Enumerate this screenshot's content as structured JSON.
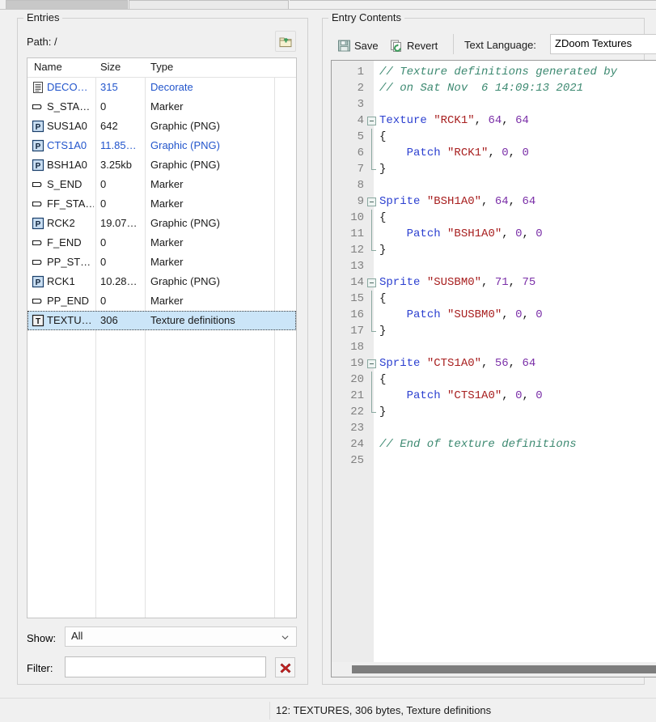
{
  "window": {
    "tabs": [
      {
        "label": "",
        "active": true
      },
      {
        "label": "",
        "active": false
      }
    ]
  },
  "entries_panel": {
    "title": "Entries",
    "path_label": "Path: /",
    "updir_icon": "folder-up-icon",
    "columns": [
      "Name",
      "Size",
      "Type"
    ],
    "rows": [
      {
        "icon": "text-document-icon",
        "name": "DECO…",
        "size": "315",
        "type": "Decorate",
        "highlight": true,
        "selected": false
      },
      {
        "icon": "marker-tag-icon",
        "name": "S_STA…",
        "size": "0",
        "type": "Marker",
        "highlight": false,
        "selected": false
      },
      {
        "icon": "png-badge-icon",
        "name": "SUS1A0",
        "size": "642",
        "type": "Graphic (PNG)",
        "highlight": false,
        "selected": false
      },
      {
        "icon": "png-badge-icon",
        "name": "CTS1A0",
        "size": "11.85…",
        "type": "Graphic (PNG)",
        "highlight": true,
        "selected": false
      },
      {
        "icon": "png-badge-icon",
        "name": "BSH1A0",
        "size": "3.25kb",
        "type": "Graphic (PNG)",
        "highlight": false,
        "selected": false
      },
      {
        "icon": "marker-tag-icon",
        "name": "S_END",
        "size": "0",
        "type": "Marker",
        "highlight": false,
        "selected": false
      },
      {
        "icon": "marker-tag-icon",
        "name": "FF_STA…",
        "size": "0",
        "type": "Marker",
        "highlight": false,
        "selected": false
      },
      {
        "icon": "png-badge-icon",
        "name": "RCK2",
        "size": "19.07…",
        "type": "Graphic (PNG)",
        "highlight": false,
        "selected": false
      },
      {
        "icon": "marker-tag-icon",
        "name": "F_END",
        "size": "0",
        "type": "Marker",
        "highlight": false,
        "selected": false
      },
      {
        "icon": "marker-tag-icon",
        "name": "PP_ST…",
        "size": "0",
        "type": "Marker",
        "highlight": false,
        "selected": false
      },
      {
        "icon": "png-badge-icon",
        "name": "RCK1",
        "size": "10.28…",
        "type": "Graphic (PNG)",
        "highlight": false,
        "selected": false
      },
      {
        "icon": "marker-tag-icon",
        "name": "PP_END",
        "size": "0",
        "type": "Marker",
        "highlight": false,
        "selected": false
      },
      {
        "icon": "texture-badge-icon",
        "name": "TEXTU…",
        "size": "306",
        "type": "Texture definitions",
        "highlight": false,
        "selected": true
      }
    ],
    "show_label": "Show:",
    "show_value": "All",
    "show_options": [
      "All"
    ],
    "filter_label": "Filter:",
    "filter_value": "",
    "filter_placeholder": "",
    "clear_icon": "red-x-icon"
  },
  "contents_panel": {
    "title": "Entry Contents",
    "save_label": "Save",
    "save_icon": "floppy-disk-icon",
    "revert_label": "Revert",
    "revert_icon": "revert-pages-icon",
    "language_label": "Text Language:",
    "language_value": "ZDoom Textures",
    "language_options": [
      "ZDoom Textures"
    ]
  },
  "editor": {
    "first_line": 1,
    "last_line": 25,
    "lines": [
      {
        "n": "1",
        "fold": "none",
        "tokens": [
          {
            "t": "comment",
            "v": "// Texture definitions generated by"
          }
        ]
      },
      {
        "n": "2",
        "fold": "none",
        "tokens": [
          {
            "t": "comment",
            "v": "// on Sat Nov  6 14:09:13 2021"
          }
        ]
      },
      {
        "n": "3",
        "fold": "none",
        "tokens": []
      },
      {
        "n": "4",
        "fold": "open",
        "tokens": [
          {
            "t": "keyword",
            "v": "Texture"
          },
          {
            "t": "punct",
            "v": " "
          },
          {
            "t": "string",
            "v": "\"RCK1\""
          },
          {
            "t": "punct",
            "v": ", "
          },
          {
            "t": "number",
            "v": "64"
          },
          {
            "t": "punct",
            "v": ", "
          },
          {
            "t": "number",
            "v": "64"
          }
        ]
      },
      {
        "n": "5",
        "fold": "bar",
        "tokens": [
          {
            "t": "punct",
            "v": "{"
          }
        ]
      },
      {
        "n": "6",
        "fold": "bar",
        "tokens": [
          {
            "t": "punct",
            "v": "    "
          },
          {
            "t": "keyword",
            "v": "Patch"
          },
          {
            "t": "punct",
            "v": " "
          },
          {
            "t": "string",
            "v": "\"RCK1\""
          },
          {
            "t": "punct",
            "v": ", "
          },
          {
            "t": "number",
            "v": "0"
          },
          {
            "t": "punct",
            "v": ", "
          },
          {
            "t": "number",
            "v": "0"
          }
        ]
      },
      {
        "n": "7",
        "fold": "close",
        "tokens": [
          {
            "t": "punct",
            "v": "}"
          }
        ]
      },
      {
        "n": "8",
        "fold": "none",
        "tokens": []
      },
      {
        "n": "9",
        "fold": "open",
        "tokens": [
          {
            "t": "keyword",
            "v": "Sprite"
          },
          {
            "t": "punct",
            "v": " "
          },
          {
            "t": "string",
            "v": "\"BSH1A0\""
          },
          {
            "t": "punct",
            "v": ", "
          },
          {
            "t": "number",
            "v": "64"
          },
          {
            "t": "punct",
            "v": ", "
          },
          {
            "t": "number",
            "v": "64"
          }
        ]
      },
      {
        "n": "10",
        "fold": "bar",
        "tokens": [
          {
            "t": "punct",
            "v": "{"
          }
        ]
      },
      {
        "n": "11",
        "fold": "bar",
        "tokens": [
          {
            "t": "punct",
            "v": "    "
          },
          {
            "t": "keyword",
            "v": "Patch"
          },
          {
            "t": "punct",
            "v": " "
          },
          {
            "t": "string",
            "v": "\"BSH1A0\""
          },
          {
            "t": "punct",
            "v": ", "
          },
          {
            "t": "number",
            "v": "0"
          },
          {
            "t": "punct",
            "v": ", "
          },
          {
            "t": "number",
            "v": "0"
          }
        ]
      },
      {
        "n": "12",
        "fold": "close",
        "tokens": [
          {
            "t": "punct",
            "v": "}"
          }
        ]
      },
      {
        "n": "13",
        "fold": "none",
        "tokens": []
      },
      {
        "n": "14",
        "fold": "open",
        "tokens": [
          {
            "t": "keyword",
            "v": "Sprite"
          },
          {
            "t": "punct",
            "v": " "
          },
          {
            "t": "string",
            "v": "\"SUSBM0\""
          },
          {
            "t": "punct",
            "v": ", "
          },
          {
            "t": "number",
            "v": "71"
          },
          {
            "t": "punct",
            "v": ", "
          },
          {
            "t": "number",
            "v": "75"
          }
        ]
      },
      {
        "n": "15",
        "fold": "bar",
        "tokens": [
          {
            "t": "punct",
            "v": "{"
          }
        ]
      },
      {
        "n": "16",
        "fold": "bar",
        "tokens": [
          {
            "t": "punct",
            "v": "    "
          },
          {
            "t": "keyword",
            "v": "Patch"
          },
          {
            "t": "punct",
            "v": " "
          },
          {
            "t": "string",
            "v": "\"SUSBM0\""
          },
          {
            "t": "punct",
            "v": ", "
          },
          {
            "t": "number",
            "v": "0"
          },
          {
            "t": "punct",
            "v": ", "
          },
          {
            "t": "number",
            "v": "0"
          }
        ]
      },
      {
        "n": "17",
        "fold": "close",
        "tokens": [
          {
            "t": "punct",
            "v": "}"
          }
        ]
      },
      {
        "n": "18",
        "fold": "none",
        "tokens": []
      },
      {
        "n": "19",
        "fold": "open",
        "tokens": [
          {
            "t": "keyword",
            "v": "Sprite"
          },
          {
            "t": "punct",
            "v": " "
          },
          {
            "t": "string",
            "v": "\"CTS1A0\""
          },
          {
            "t": "punct",
            "v": ", "
          },
          {
            "t": "number",
            "v": "56"
          },
          {
            "t": "punct",
            "v": ", "
          },
          {
            "t": "number",
            "v": "64"
          }
        ]
      },
      {
        "n": "20",
        "fold": "bar",
        "tokens": [
          {
            "t": "punct",
            "v": "{"
          }
        ]
      },
      {
        "n": "21",
        "fold": "bar",
        "tokens": [
          {
            "t": "punct",
            "v": "    "
          },
          {
            "t": "keyword",
            "v": "Patch"
          },
          {
            "t": "punct",
            "v": " "
          },
          {
            "t": "string",
            "v": "\"CTS1A0\""
          },
          {
            "t": "punct",
            "v": ", "
          },
          {
            "t": "number",
            "v": "0"
          },
          {
            "t": "punct",
            "v": ", "
          },
          {
            "t": "number",
            "v": "0"
          }
        ]
      },
      {
        "n": "22",
        "fold": "close",
        "tokens": [
          {
            "t": "punct",
            "v": "}"
          }
        ]
      },
      {
        "n": "23",
        "fold": "none",
        "tokens": []
      },
      {
        "n": "24",
        "fold": "none",
        "tokens": [
          {
            "t": "comment",
            "v": "// End of texture definitions"
          }
        ]
      },
      {
        "n": "25",
        "fold": "none",
        "tokens": []
      }
    ]
  },
  "statusbar": {
    "text": "12: TEXTURES, 306 bytes, Texture definitions"
  },
  "colors": {
    "selection": "#cbe5f8",
    "link_blue": "#2255cc",
    "comment": "#3e8a72",
    "keyword": "#2b3fd0",
    "string": "#a82020",
    "number": "#7b30a8",
    "panel_bg": "#f0f0f0"
  }
}
